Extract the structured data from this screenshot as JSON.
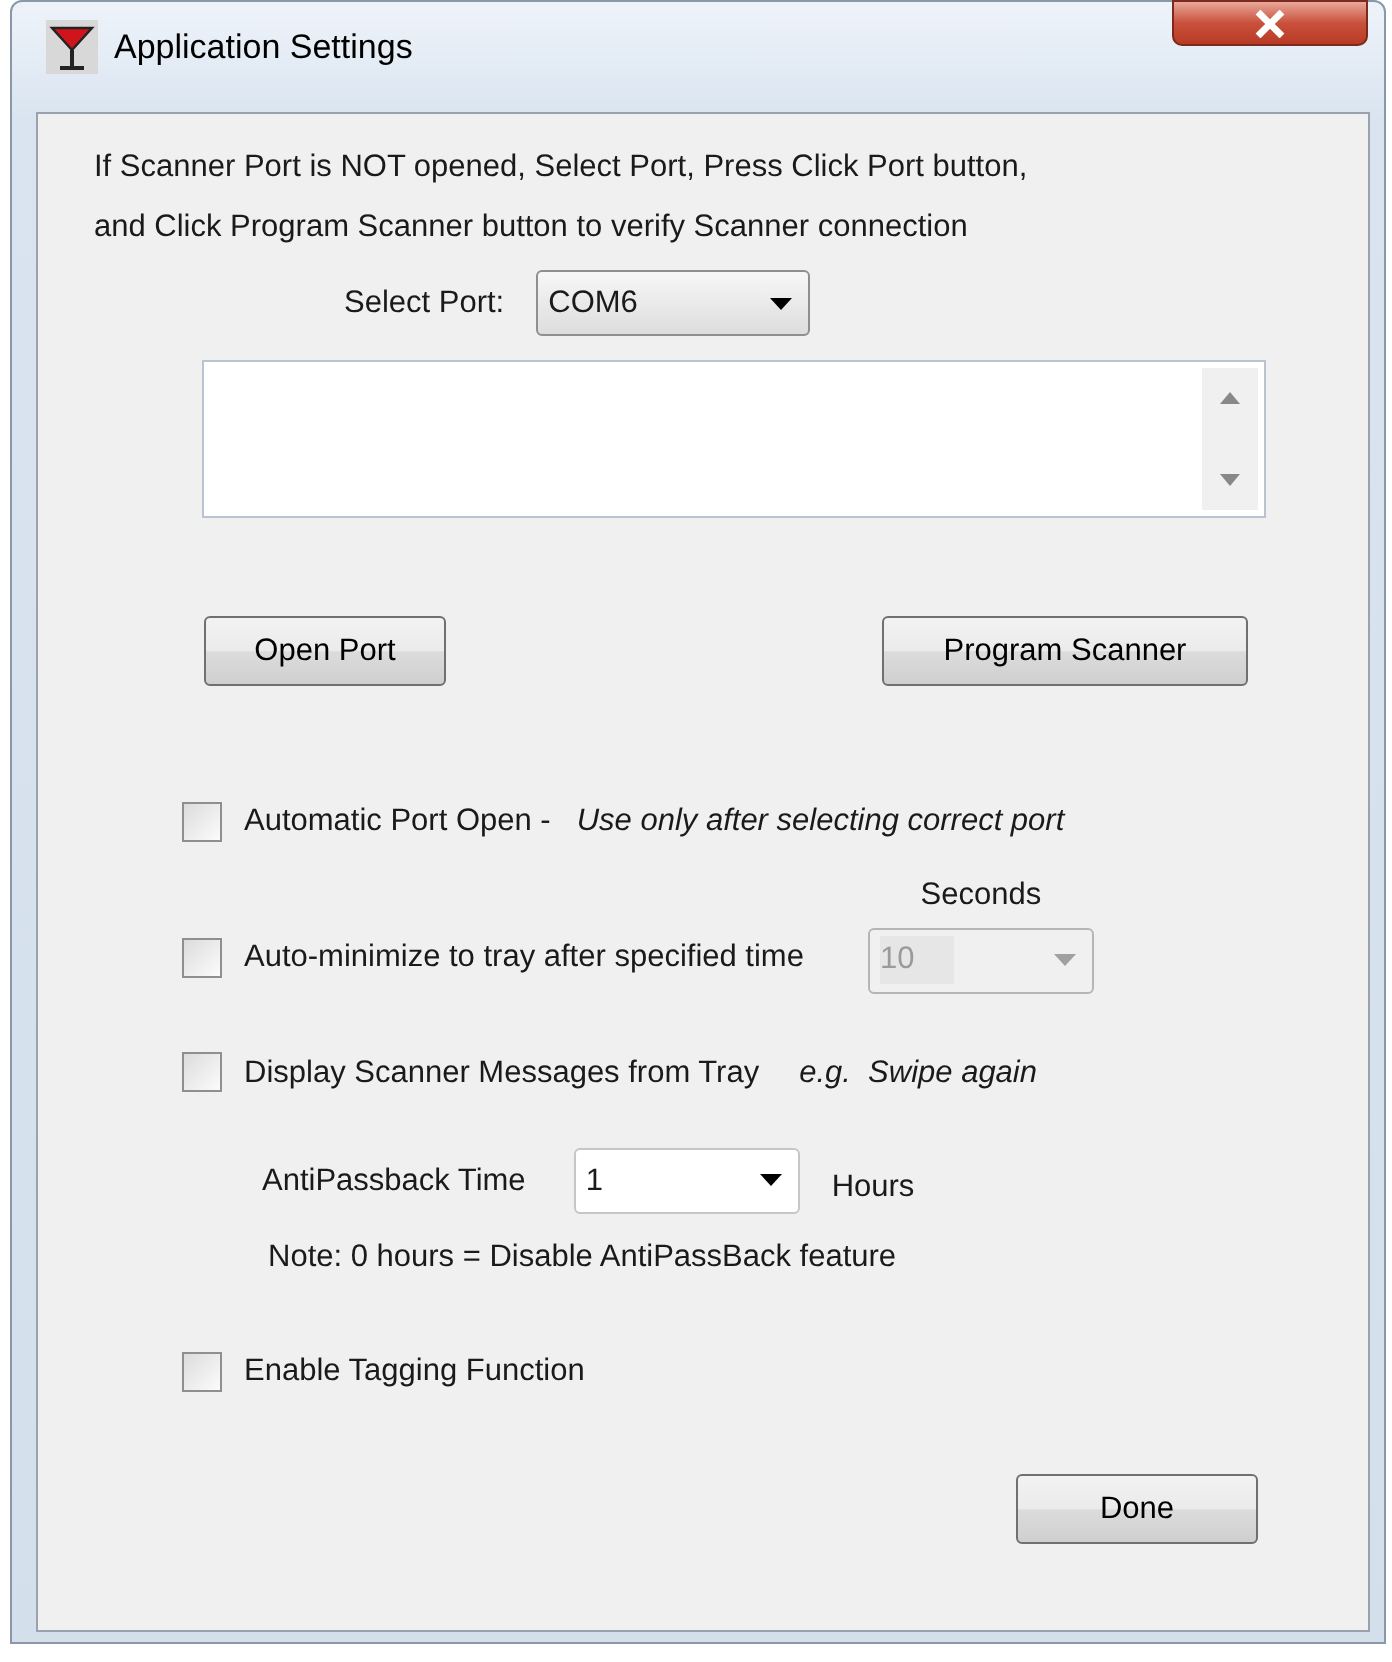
{
  "window": {
    "title": "Application Settings"
  },
  "instruction_lines": [
    "If Scanner Port is NOT opened, Select Port, Press Click Port button,",
    "and Click Program Scanner button to verify Scanner connection"
  ],
  "port": {
    "label": "Select Port:",
    "value": "COM6"
  },
  "buttons": [
    {
      "label": "Open Port"
    },
    {
      "label": "Program Scanner"
    }
  ],
  "options": [
    {
      "label": "Automatic Port Open -",
      "hint": "Use only after selecting correct port",
      "checked": false
    },
    {
      "label": "Auto-minimize to tray after specified time",
      "checked": false,
      "seconds": {
        "label": "Seconds",
        "value": "10",
        "disabled": true
      }
    },
    {
      "label": "Display Scanner Messages from Tray",
      "hint": "e.g.  Swipe again",
      "checked": false
    }
  ],
  "antipassback": {
    "label": "AntiPassback Time",
    "value": "1",
    "unit": "Hours",
    "note": "Note: 0 hours = Disable AntiPassBack feature"
  },
  "tagging": {
    "label": "Enable Tagging Function",
    "checked": false
  },
  "done_button": {
    "label": "Done"
  }
}
